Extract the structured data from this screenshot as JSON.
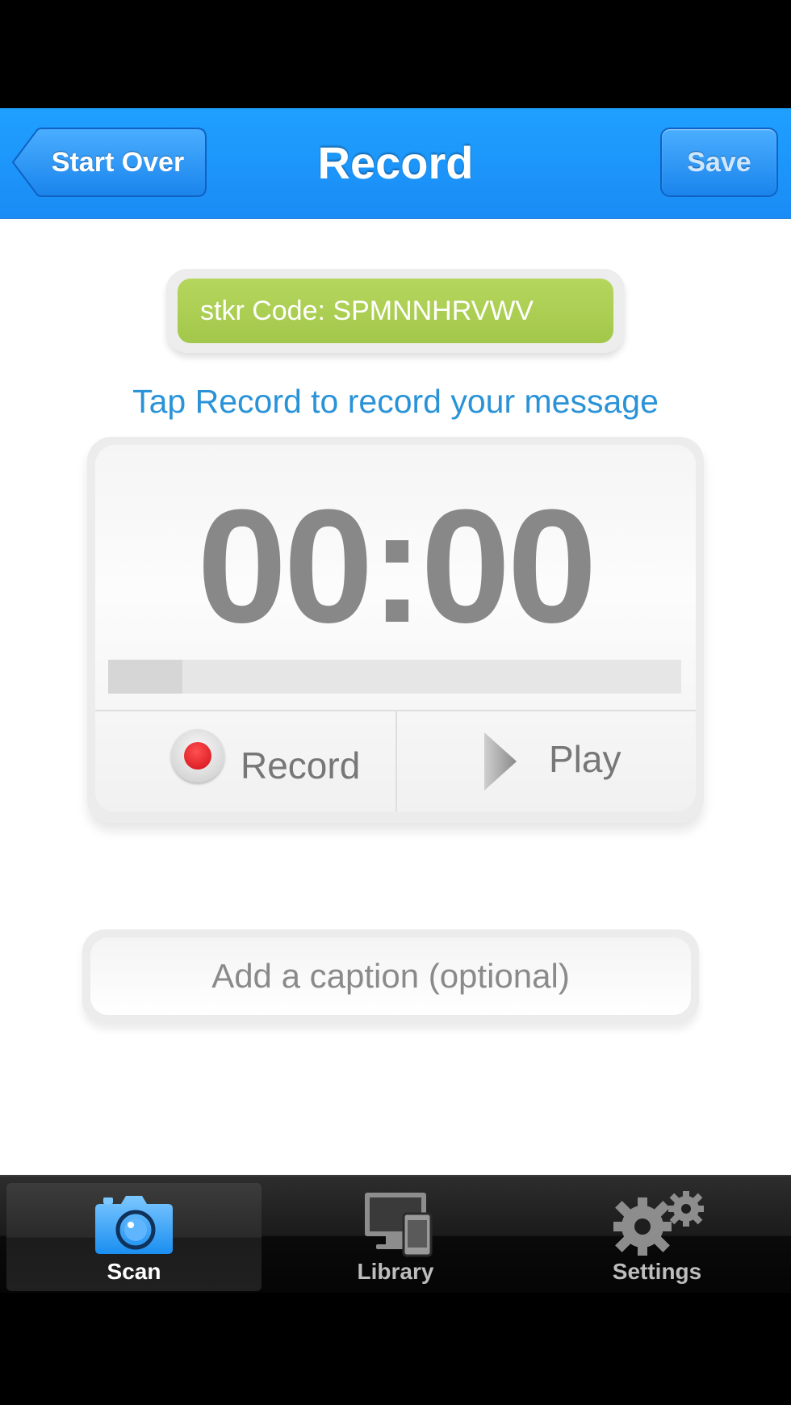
{
  "nav": {
    "back_label": "Start Over",
    "title": "Record",
    "save_label": "Save"
  },
  "code": {
    "label": "stkr Code: SPMNNHRVWV"
  },
  "instruction": "Tap Record to record your message",
  "recorder": {
    "timer": "00:00",
    "progress_fraction": 0.13,
    "record_label": "Record",
    "play_label": "Play"
  },
  "caption": {
    "placeholder": "Add a caption (optional)",
    "value": ""
  },
  "tabs": [
    {
      "label": "Scan",
      "icon": "camera-icon",
      "active": true
    },
    {
      "label": "Library",
      "icon": "devices-icon",
      "active": false
    },
    {
      "label": "Settings",
      "icon": "gears-icon",
      "active": false
    }
  ],
  "colors": {
    "nav_blue": "#1a8cf5",
    "code_green": "#a2c74a",
    "instruction_blue": "#2a93d8",
    "record_red": "#d10f1a"
  }
}
